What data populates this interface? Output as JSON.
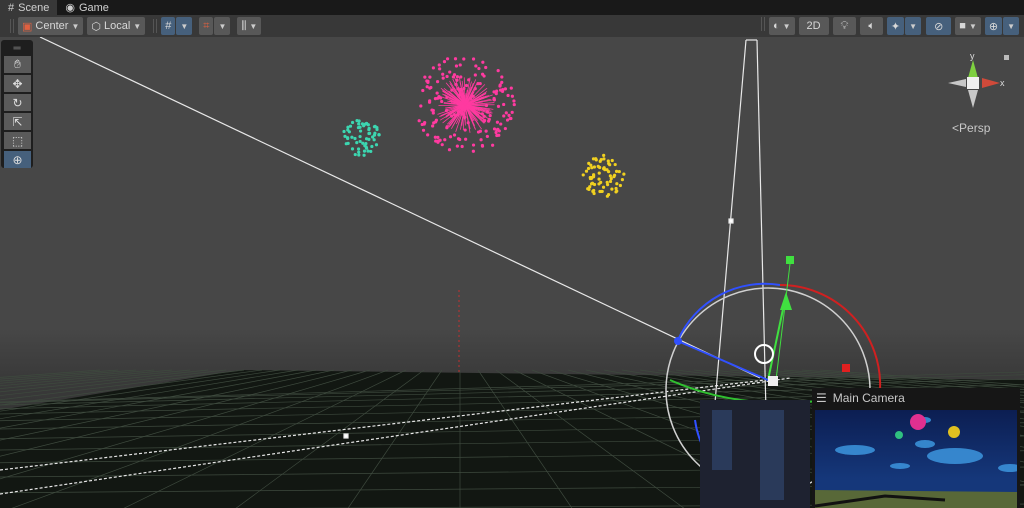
{
  "tabs": [
    {
      "label": "Scene",
      "icon": "grid-icon"
    },
    {
      "label": "Game",
      "icon": "gamepad-icon"
    }
  ],
  "toolbar": {
    "pivot": "Center",
    "space": "Local",
    "twod": "2D"
  },
  "tools": [
    "hand",
    "move",
    "rotate",
    "scale",
    "rect",
    "transform"
  ],
  "gizmo": {
    "y": "y",
    "x": "x",
    "projection": "Persp"
  },
  "camera_preview": {
    "title": "Main Camera"
  },
  "colors": {
    "accent": "#46607c",
    "pink": "#ff3aa0",
    "teal": "#3cd6b0",
    "yellow": "#f0d020"
  }
}
